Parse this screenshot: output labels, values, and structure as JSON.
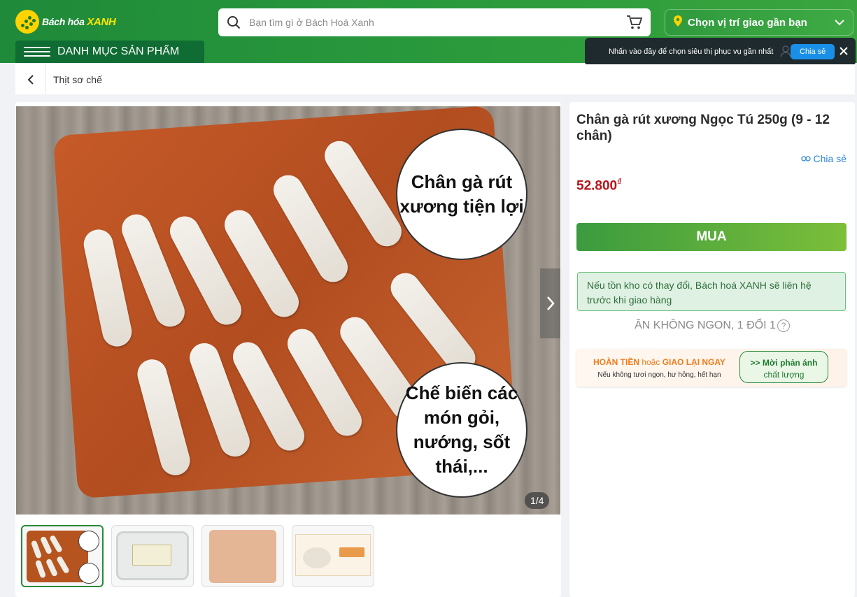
{
  "header": {
    "logo_text_prefix": "Bách hóa ",
    "logo_text_brand": "XANH",
    "search": {
      "placeholder": "Bạn tìm gì ở Bách Hoá Xanh",
      "value": ""
    },
    "location_label": "Chọn vị trí giao gần bạn",
    "menu_label": "DANH MỤC SẢN PHẨM",
    "tooltip": {
      "text": "Nhấn vào đây để chọn siêu thị phục vụ gần nhất",
      "share_button": "Chia sẻ"
    }
  },
  "breadcrumb": {
    "category": "Thịt sơ chế"
  },
  "gallery": {
    "bubble_1": "Chân gà rút xương tiện lợi",
    "bubble_2": "Chế biến các món gỏi, nướng, sốt thái,...",
    "counter": "1/4",
    "thumbnails": [
      "thumb-1",
      "thumb-2",
      "thumb-3",
      "thumb-4"
    ]
  },
  "product": {
    "title": "Chân gà rút xương Ngọc Tú 250g (9 - 12 chân)",
    "share_label": "Chia sẻ",
    "price": "52.800",
    "currency": "₫",
    "buy_label": "MUA",
    "notice": "Nếu tồn kho có thay đổi, Bách hoá XANH sẽ liên hệ trước khi giao hàng",
    "guarantee": "ĂN KHÔNG NGON, 1 ĐỔI 1",
    "refund": {
      "part1": "HOÀN TIỀN",
      "part2": " hoặc ",
      "part3": "GIAO LẠI NGAY",
      "subtitle": "Nếu không tươi ngon, hư hỏng, hết hạn",
      "feedback_line1": ">> Mời phản ánh",
      "feedback_line2": "chất lượng"
    }
  },
  "colors": {
    "brand_green": "#1f8a3a",
    "price_red": "#b8141b",
    "accent_yellow": "#ffd400"
  }
}
